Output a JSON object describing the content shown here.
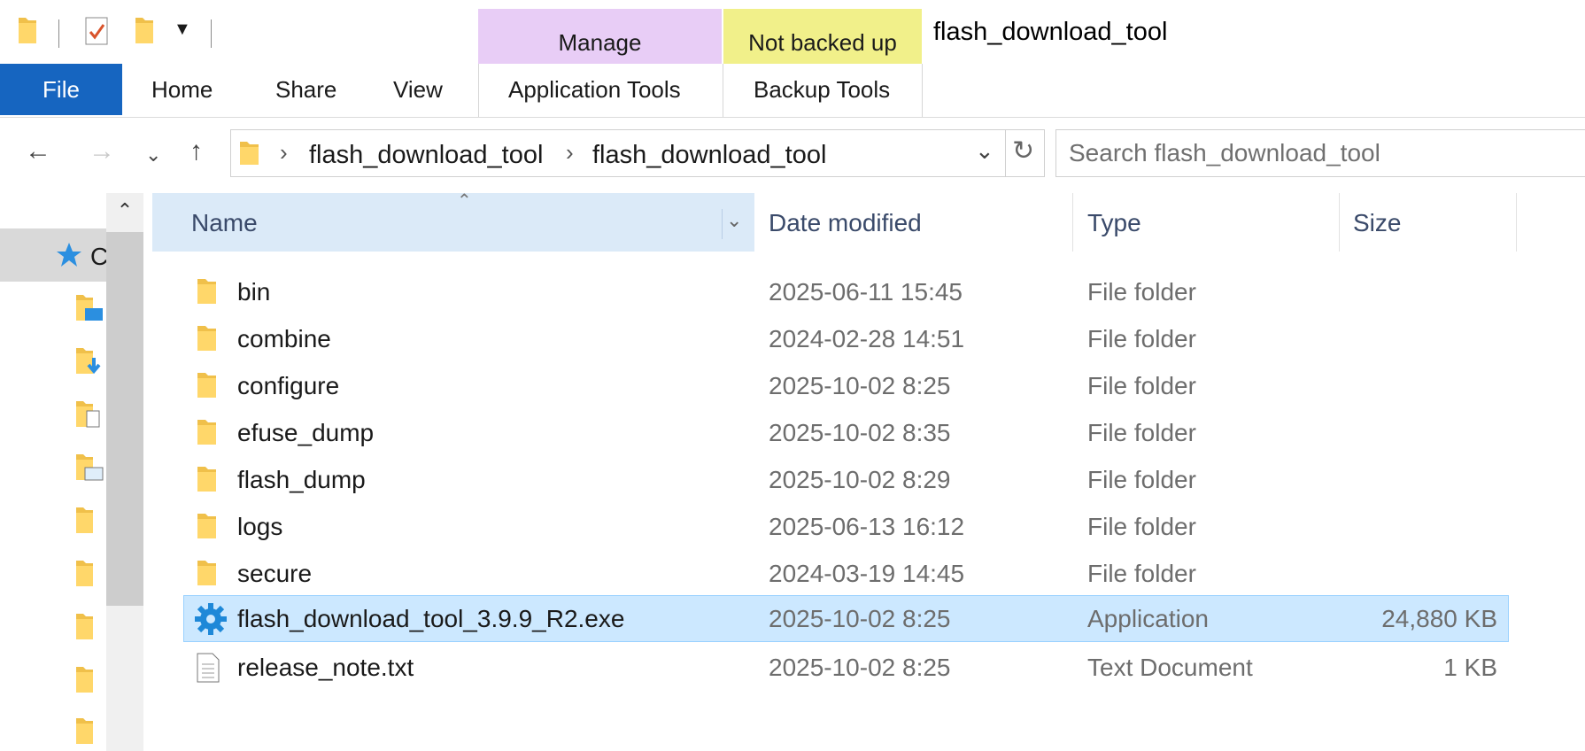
{
  "titlebar": {
    "window_title": "flash_download_tool",
    "context_groups": [
      {
        "label": "Manage",
        "color": "#e8cdf6"
      },
      {
        "label": "Not backed up",
        "color": "#f1f08a"
      }
    ]
  },
  "ribbon": {
    "file_tab": "File",
    "tabs": [
      "Home",
      "Share",
      "View",
      "Application Tools",
      "Backup Tools"
    ],
    "file_color": "#1665c0"
  },
  "address": {
    "crumbs": [
      "flash_download_tool",
      "flash_download_tool"
    ]
  },
  "search": {
    "placeholder": "Search flash_download_tool"
  },
  "nav": {
    "quick_access_label": "C"
  },
  "columns": {
    "name": "Name",
    "date": "Date modified",
    "type": "Type",
    "size": "Size"
  },
  "files": [
    {
      "name": "bin",
      "date": "2025-06-11 15:45",
      "type": "File folder",
      "size": "",
      "icon": "folder-icon"
    },
    {
      "name": "combine",
      "date": "2024-02-28 14:51",
      "type": "File folder",
      "size": "",
      "icon": "folder-icon"
    },
    {
      "name": "configure",
      "date": "2025-10-02 8:25",
      "type": "File folder",
      "size": "",
      "icon": "folder-icon"
    },
    {
      "name": "efuse_dump",
      "date": "2025-10-02 8:35",
      "type": "File folder",
      "size": "",
      "icon": "folder-icon"
    },
    {
      "name": "flash_dump",
      "date": "2025-10-02 8:29",
      "type": "File folder",
      "size": "",
      "icon": "folder-icon"
    },
    {
      "name": "logs",
      "date": "2025-06-13 16:12",
      "type": "File folder",
      "size": "",
      "icon": "folder-icon"
    },
    {
      "name": "secure",
      "date": "2024-03-19 14:45",
      "type": "File folder",
      "size": "",
      "icon": "folder-icon"
    },
    {
      "name": "flash_download_tool_3.9.9_R2.exe",
      "date": "2025-10-02 8:25",
      "type": "Application",
      "size": "24,880 KB",
      "icon": "gear-app-icon",
      "selected": true
    },
    {
      "name": "release_note.txt",
      "date": "2025-10-02 8:25",
      "type": "Text Document",
      "size": "1 KB",
      "icon": "text-file-icon"
    }
  ],
  "colors": {
    "selection": "#cce8ff",
    "selection_border": "#99d1ff",
    "header_sorted": "#dbeaf8"
  }
}
